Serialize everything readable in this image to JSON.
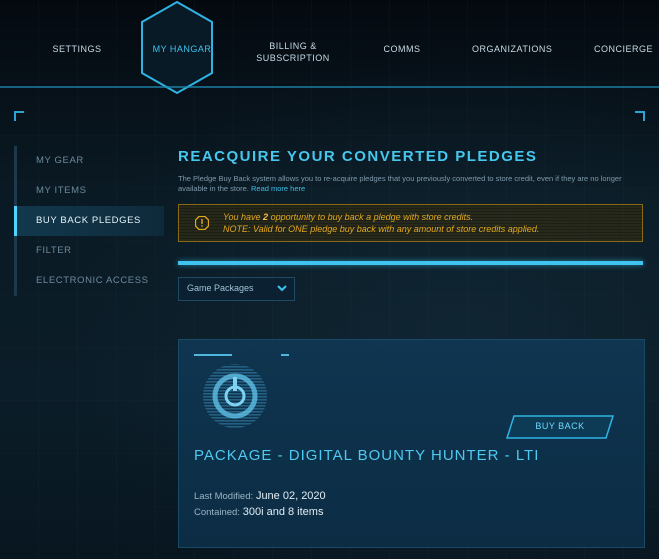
{
  "nav": {
    "items": [
      {
        "label": "SETTINGS",
        "active": false
      },
      {
        "label": "MY HANGAR",
        "active": true
      },
      {
        "label": "BILLING & SUBSCRIPTION",
        "line1": "BILLING &",
        "line2": "SUBSCRIPTION",
        "active": false
      },
      {
        "label": "COMMS",
        "active": false
      },
      {
        "label": "ORGANIZATIONS",
        "active": false
      },
      {
        "label": "CONCIERGE",
        "active": false
      }
    ]
  },
  "sidebar": {
    "items": [
      {
        "label": "MY GEAR",
        "active": false
      },
      {
        "label": "MY ITEMS",
        "active": false
      },
      {
        "label": "BUY BACK PLEDGES",
        "active": true
      },
      {
        "label": "FILTER",
        "active": false
      },
      {
        "label": "ELECTRONIC ACCESS",
        "active": false
      }
    ]
  },
  "main": {
    "title": "REACQUIRE YOUR CONVERTED PLEDGES",
    "intro": "The Pledge Buy Back system allows you to re-acquire pledges that you previously converted to store credit, even if they are no longer available in the store.",
    "intro_link": "Read more here",
    "alert": {
      "pre": "You have ",
      "count": "2",
      "post": " opportunity to buy back a pledge with store credits.",
      "note": "NOTE: Valid for ONE pledge buy back with any amount of store credits applied."
    },
    "filter": {
      "selected": "Game Packages"
    },
    "card": {
      "title": "PACKAGE - DIGITAL BOUNTY HUNTER - LTI",
      "button": "BUY BACK",
      "last_modified_label": "Last Modified:",
      "last_modified_value": "June 02, 2020",
      "contained_label": "Contained:",
      "contained_value": "300i and 8 items"
    }
  },
  "colors": {
    "accent": "#46c7ee",
    "warning": "#e2a71e",
    "background": "#061018"
  }
}
